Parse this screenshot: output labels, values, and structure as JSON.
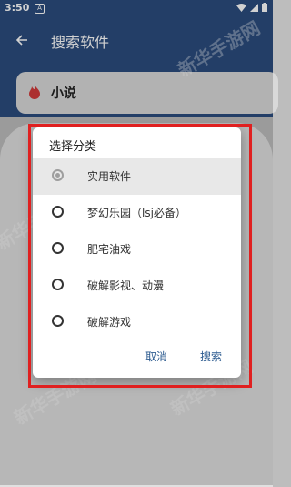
{
  "status_bar": {
    "time": "3:50",
    "notification": "A"
  },
  "app_bar": {
    "title": "搜索软件"
  },
  "search": {
    "value": "小说"
  },
  "dialog": {
    "title": "选择分类",
    "options": [
      {
        "label": "实用软件",
        "selected": true
      },
      {
        "label": "梦幻乐园（lsj必备）",
        "selected": false
      },
      {
        "label": "肥宅油戏",
        "selected": false
      },
      {
        "label": "破解影视、动漫",
        "selected": false
      },
      {
        "label": "破解游戏",
        "selected": false
      }
    ],
    "cancel_label": "取消",
    "search_label": "搜索"
  },
  "watermark": "新华手游网",
  "colors": {
    "primary": "#2b4c7e",
    "highlight_frame": "#e02020",
    "accent_text": "#2b5a8f"
  }
}
